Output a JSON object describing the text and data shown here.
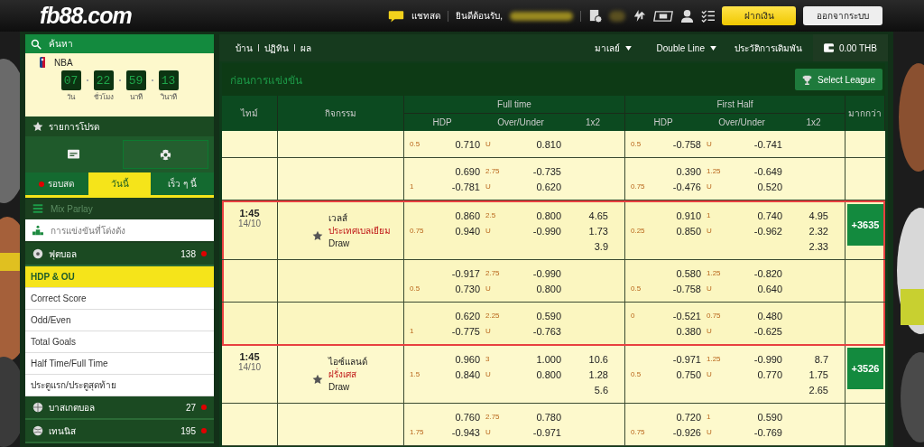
{
  "header": {
    "logo": "fb88.com",
    "chat": "แชทสด",
    "welcome": "ยินดีต้อนรับ,",
    "deposit": "ฝากเงิน",
    "logout": "ออกจากระบบ"
  },
  "sidebar": {
    "search": "ค้นหา",
    "featured": {
      "league": "NBA",
      "countdown": [
        {
          "value": "07",
          "unit": "วัน"
        },
        {
          "value": "22",
          "unit": "ชั่วโมง"
        },
        {
          "value": "59",
          "unit": "นาที"
        },
        {
          "value": "13",
          "unit": "วินาที"
        }
      ]
    },
    "favorites": "รายการโปรด",
    "view_tabs": [
      {
        "kind": "card",
        "selected": false
      },
      {
        "kind": "ball",
        "selected": true
      }
    ],
    "time_tabs": [
      {
        "label": "รอบสด",
        "live": true,
        "selected": false
      },
      {
        "label": "วันนี้",
        "live": false,
        "selected": true
      },
      {
        "label": "เร็ว ๆ นี้",
        "live": false,
        "selected": false
      }
    ],
    "mix_parlay": "Mix Parlay",
    "popular": "การแข่งขันที่โด่งดัง",
    "sports": [
      {
        "kind": "football",
        "name": "ฟุตบอล",
        "count": "138",
        "live": true,
        "markets": [
          {
            "label": "HDP & OU",
            "selected": true
          },
          {
            "label": "Correct Score",
            "selected": false
          },
          {
            "label": "Odd/Even",
            "selected": false
          },
          {
            "label": "Total Goals",
            "selected": false
          },
          {
            "label": "Half Time/Full Time",
            "selected": false
          },
          {
            "label": "ประตูแรก/ประตูสุดท้าย",
            "selected": false
          }
        ]
      },
      {
        "kind": "basketball",
        "name": "บาสเกตบอล",
        "count": "27",
        "live": true
      },
      {
        "kind": "tennis",
        "name": "เทนนิส",
        "count": "195",
        "live": true
      }
    ]
  },
  "nav": {
    "links": [
      "บ้าน",
      "ปฏิทิน",
      "ผล"
    ],
    "dropdowns": [
      "มาเลย์",
      "Double Line"
    ],
    "history": "ประวัติการเดิมพัน",
    "balance": "0.00 THB"
  },
  "section": {
    "title": "ก่อนการแข่งขัน",
    "select_league": "Select League"
  },
  "table": {
    "time": "ไทม์",
    "event": "กิจกรรม",
    "more": "มากกว่า",
    "groups": [
      {
        "title": "Full time",
        "columns": [
          "HDP",
          "Over/Under",
          "1x2"
        ]
      },
      {
        "title": "First Half",
        "columns": [
          "HDP",
          "Over/Under",
          "1x2"
        ]
      }
    ],
    "rows": [
      {
        "highlighted": false,
        "ft": {
          "lines": [
            {
              "hdp": "0.5",
              "odds": "0.710",
              "ou": "U",
              "ou_odds": "0.810"
            }
          ]
        },
        "fh": {
          "lines": [
            {
              "hdp": "0.5",
              "odds": "-0.758",
              "ou": "U",
              "ou_odds": "-0.741"
            }
          ]
        }
      },
      {
        "highlighted": false,
        "ft": {
          "lines": [
            {
              "odds": "0.690",
              "ou": "2.75",
              "ou_odds": "-0.735"
            },
            {
              "hdp": "1",
              "odds": "-0.781",
              "ou": "U",
              "ou_odds": "0.620"
            }
          ]
        },
        "fh": {
          "lines": [
            {
              "odds": "0.390",
              "ou": "1.25",
              "ou_odds": "-0.649"
            },
            {
              "hdp": "0.75",
              "odds": "-0.476",
              "ou": "U",
              "ou_odds": "0.520"
            }
          ]
        }
      },
      {
        "highlighted": true,
        "time": "1:45",
        "date": "14/10",
        "home": "เวลส์",
        "away": "ประเทศเบลเยียม",
        "draw": "Draw",
        "more": "+3635",
        "ft": {
          "lines": [
            {
              "odds": "0.860",
              "ou": "2.5",
              "ou_odds": "0.800"
            },
            {
              "hdp": "0.75",
              "odds": "0.940",
              "ou": "U",
              "ou_odds": "-0.990"
            }
          ],
          "x12": [
            "4.65",
            "1.73",
            "3.9"
          ]
        },
        "fh": {
          "lines": [
            {
              "odds": "0.910",
              "ou": "1",
              "ou_odds": "0.740"
            },
            {
              "hdp": "0.25",
              "odds": "0.850",
              "ou": "U",
              "ou_odds": "-0.962"
            }
          ],
          "x12": [
            "4.95",
            "2.32",
            "2.33"
          ]
        }
      },
      {
        "highlighted": true,
        "ft": {
          "lines": [
            {
              "odds": "-0.917",
              "ou": "2.75",
              "ou_odds": "-0.990"
            },
            {
              "hdp": "0.5",
              "odds": "0.730",
              "ou": "U",
              "ou_odds": "0.800"
            }
          ]
        },
        "fh": {
          "lines": [
            {
              "odds": "0.580",
              "ou": "1.25",
              "ou_odds": "-0.820"
            },
            {
              "hdp": "0.5",
              "odds": "-0.758",
              "ou": "U",
              "ou_odds": "0.640"
            }
          ]
        }
      },
      {
        "highlighted": true,
        "ft": {
          "lines": [
            {
              "odds": "0.620",
              "ou": "2.25",
              "ou_odds": "0.590"
            },
            {
              "hdp": "1",
              "odds": "-0.775",
              "ou": "U",
              "ou_odds": "-0.763"
            }
          ]
        },
        "fh": {
          "lines": [
            {
              "hdp": "0",
              "odds": "-0.521",
              "ou": "0.75",
              "ou_odds": "0.480"
            },
            {
              "odds": "0.380",
              "ou": "U",
              "ou_odds": "-0.625"
            }
          ]
        }
      },
      {
        "highlighted": false,
        "time": "1:45",
        "date": "14/10",
        "home": "ไอซ์แลนด์",
        "away": "ฝรั่งเศส",
        "draw": "Draw",
        "more": "+3526",
        "ft": {
          "lines": [
            {
              "odds": "0.960",
              "ou": "3",
              "ou_odds": "1.000"
            },
            {
              "hdp": "1.5",
              "odds": "0.840",
              "ou": "U",
              "ou_odds": "0.800"
            }
          ],
          "x12": [
            "10.6",
            "1.28",
            "5.6"
          ]
        },
        "fh": {
          "lines": [
            {
              "odds": "-0.971",
              "ou": "1.25",
              "ou_odds": "-0.990"
            },
            {
              "hdp": "0.5",
              "odds": "0.750",
              "ou": "U",
              "ou_odds": "0.770"
            }
          ],
          "x12": [
            "8.7",
            "1.75",
            "2.65"
          ]
        }
      },
      {
        "highlighted": false,
        "ft": {
          "lines": [
            {
              "odds": "0.760",
              "ou": "2.75",
              "ou_odds": "0.780"
            },
            {
              "hdp": "1.75",
              "odds": "-0.943",
              "ou": "U",
              "ou_odds": "-0.971"
            }
          ]
        },
        "fh": {
          "lines": [
            {
              "odds": "0.720",
              "ou": "1",
              "ou_odds": "0.590"
            },
            {
              "hdp": "0.75",
              "odds": "-0.926",
              "ou": "U",
              "ou_odds": "-0.769"
            }
          ]
        }
      }
    ]
  }
}
